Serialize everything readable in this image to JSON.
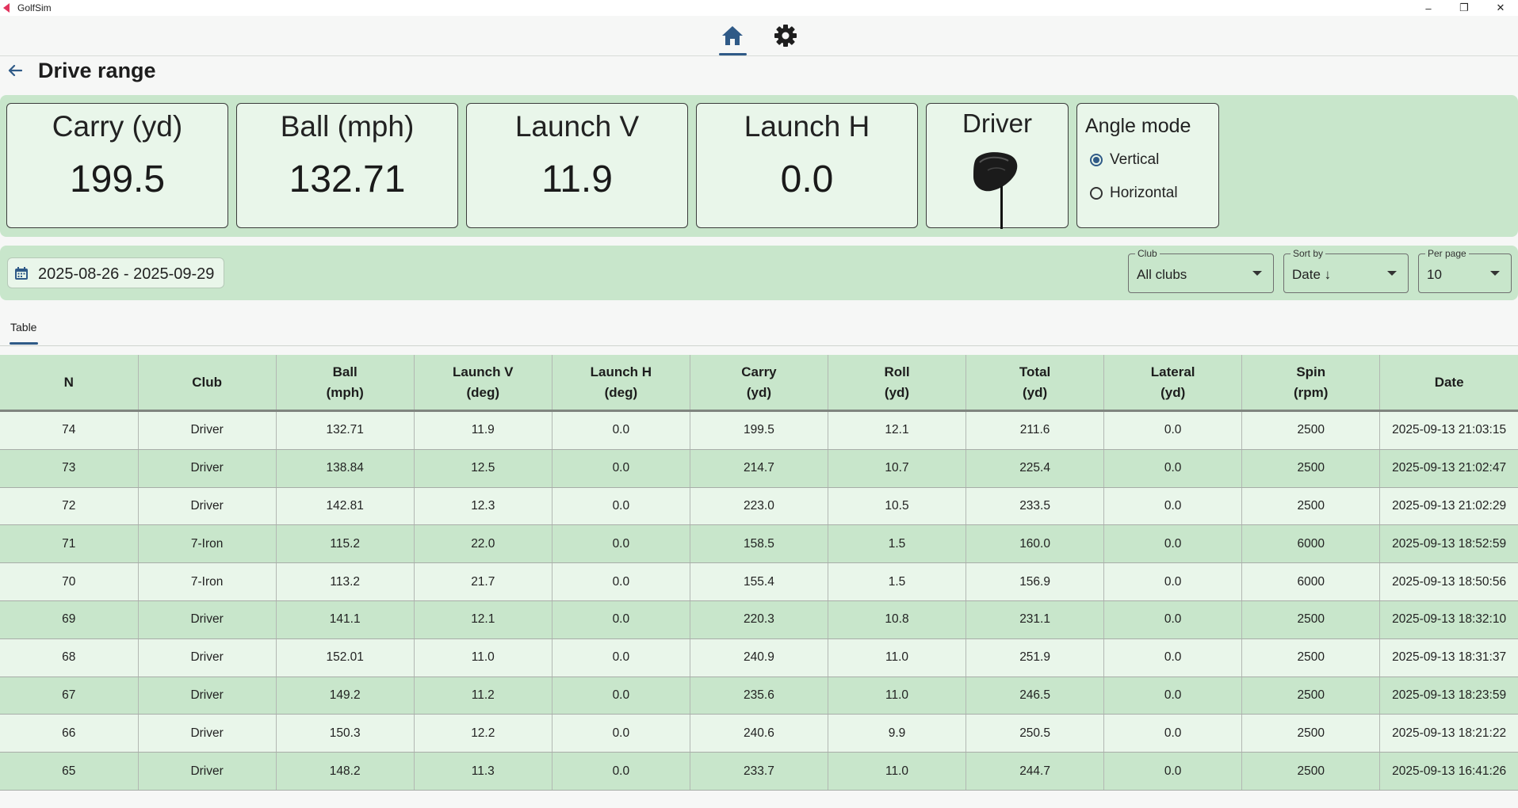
{
  "window": {
    "title": "GolfSim",
    "minimize": "–",
    "maximize": "❐",
    "close": "✕"
  },
  "nav": {
    "home_icon": "home-icon",
    "settings_icon": "gear-icon",
    "active": "home"
  },
  "header": {
    "title": "Drive range",
    "back_icon": "arrow-left-icon"
  },
  "metrics": [
    {
      "label": "Carry (yd)",
      "value": "199.5"
    },
    {
      "label": "Ball (mph)",
      "value": "132.71"
    },
    {
      "label": "Launch V",
      "value": "11.9"
    },
    {
      "label": "Launch H",
      "value": "0.0"
    }
  ],
  "club_card": {
    "label": "Driver",
    "image": "driver-club-image"
  },
  "angle_mode": {
    "title": "Angle mode",
    "options": [
      "Vertical",
      "Horizontal"
    ],
    "selected": "Vertical"
  },
  "filters": {
    "date_range": "2025-08-26 - 2025-09-29",
    "club": {
      "label": "Club",
      "value": "All clubs"
    },
    "sort": {
      "label": "Sort by",
      "value": "Date ↓"
    },
    "per_page": {
      "label": "Per page",
      "value": "10"
    }
  },
  "tabs": [
    {
      "label": "Table",
      "active": true
    }
  ],
  "table": {
    "columns": [
      {
        "line1": "N",
        "line2": ""
      },
      {
        "line1": "Club",
        "line2": ""
      },
      {
        "line1": "Ball",
        "line2": "(mph)"
      },
      {
        "line1": "Launch V",
        "line2": "(deg)"
      },
      {
        "line1": "Launch H",
        "line2": "(deg)"
      },
      {
        "line1": "Carry",
        "line2": "(yd)"
      },
      {
        "line1": "Roll",
        "line2": "(yd)"
      },
      {
        "line1": "Total",
        "line2": "(yd)"
      },
      {
        "line1": "Lateral",
        "line2": "(yd)"
      },
      {
        "line1": "Spin",
        "line2": "(rpm)"
      },
      {
        "line1": "Date",
        "line2": ""
      }
    ],
    "rows": [
      [
        "74",
        "Driver",
        "132.71",
        "11.9",
        "0.0",
        "199.5",
        "12.1",
        "211.6",
        "0.0",
        "2500",
        "2025-09-13 21:03:15"
      ],
      [
        "73",
        "Driver",
        "138.84",
        "12.5",
        "0.0",
        "214.7",
        "10.7",
        "225.4",
        "0.0",
        "2500",
        "2025-09-13 21:02:47"
      ],
      [
        "72",
        "Driver",
        "142.81",
        "12.3",
        "0.0",
        "223.0",
        "10.5",
        "233.5",
        "0.0",
        "2500",
        "2025-09-13 21:02:29"
      ],
      [
        "71",
        "7-Iron",
        "115.2",
        "22.0",
        "0.0",
        "158.5",
        "1.5",
        "160.0",
        "0.0",
        "6000",
        "2025-09-13 18:52:59"
      ],
      [
        "70",
        "7-Iron",
        "113.2",
        "21.7",
        "0.0",
        "155.4",
        "1.5",
        "156.9",
        "0.0",
        "6000",
        "2025-09-13 18:50:56"
      ],
      [
        "69",
        "Driver",
        "141.1",
        "12.1",
        "0.0",
        "220.3",
        "10.8",
        "231.1",
        "0.0",
        "2500",
        "2025-09-13 18:32:10"
      ],
      [
        "68",
        "Driver",
        "152.01",
        "11.0",
        "0.0",
        "240.9",
        "11.0",
        "251.9",
        "0.0",
        "2500",
        "2025-09-13 18:31:37"
      ],
      [
        "67",
        "Driver",
        "149.2",
        "11.2",
        "0.0",
        "235.6",
        "11.0",
        "246.5",
        "0.0",
        "2500",
        "2025-09-13 18:23:59"
      ],
      [
        "66",
        "Driver",
        "150.3",
        "12.2",
        "0.0",
        "240.6",
        "9.9",
        "250.5",
        "0.0",
        "2500",
        "2025-09-13 18:21:22"
      ],
      [
        "65",
        "Driver",
        "148.2",
        "11.3",
        "0.0",
        "233.7",
        "11.0",
        "244.7",
        "0.0",
        "2500",
        "2025-09-13 16:41:26"
      ]
    ]
  },
  "colors": {
    "panel_green": "#c8e6cb",
    "card_light": "#e9f6ea",
    "accent_blue": "#2f5a87"
  }
}
